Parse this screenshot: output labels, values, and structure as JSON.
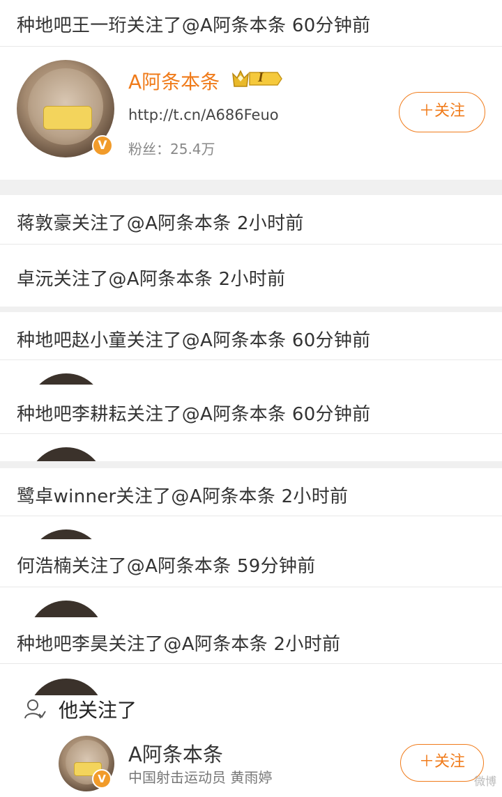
{
  "top_notice": "种地吧王一珩关注了@A阿条本条 60分钟前",
  "profile": {
    "name": "A阿条本条",
    "link": "http://t.cn/A686Feuo",
    "fans_label": "粉丝：",
    "fans_count": "25.4万",
    "follow_label": "＋关注",
    "level_badge": "I",
    "verified_mark": "V"
  },
  "notices": [
    "蒋敦豪关注了@A阿条本条 2小时前",
    "卓沅关注了@A阿条本条 2小时前",
    "种地吧赵小童关注了@A阿条本条 60分钟前",
    "种地吧李耕耘关注了@A阿条本条 60分钟前",
    "鹭卓winner关注了@A阿条本条 2小时前",
    "何浩楠关注了@A阿条本条 59分钟前",
    "种地吧李昊关注了@A阿条本条 2小时前"
  ],
  "peek_name": "A阿条本条",
  "bottom": {
    "title": "他关注了",
    "name": "A阿条本条",
    "bio": "中国射击运动员 黄雨婷",
    "follow_label": "＋关注",
    "watermark": "微博"
  },
  "colors": {
    "accent": "#f07b1a",
    "divider": "#f0f0f0",
    "badge": "#f19b2a"
  },
  "icons": [
    "crown-level-icon",
    "verified-icon",
    "person-icon"
  ]
}
